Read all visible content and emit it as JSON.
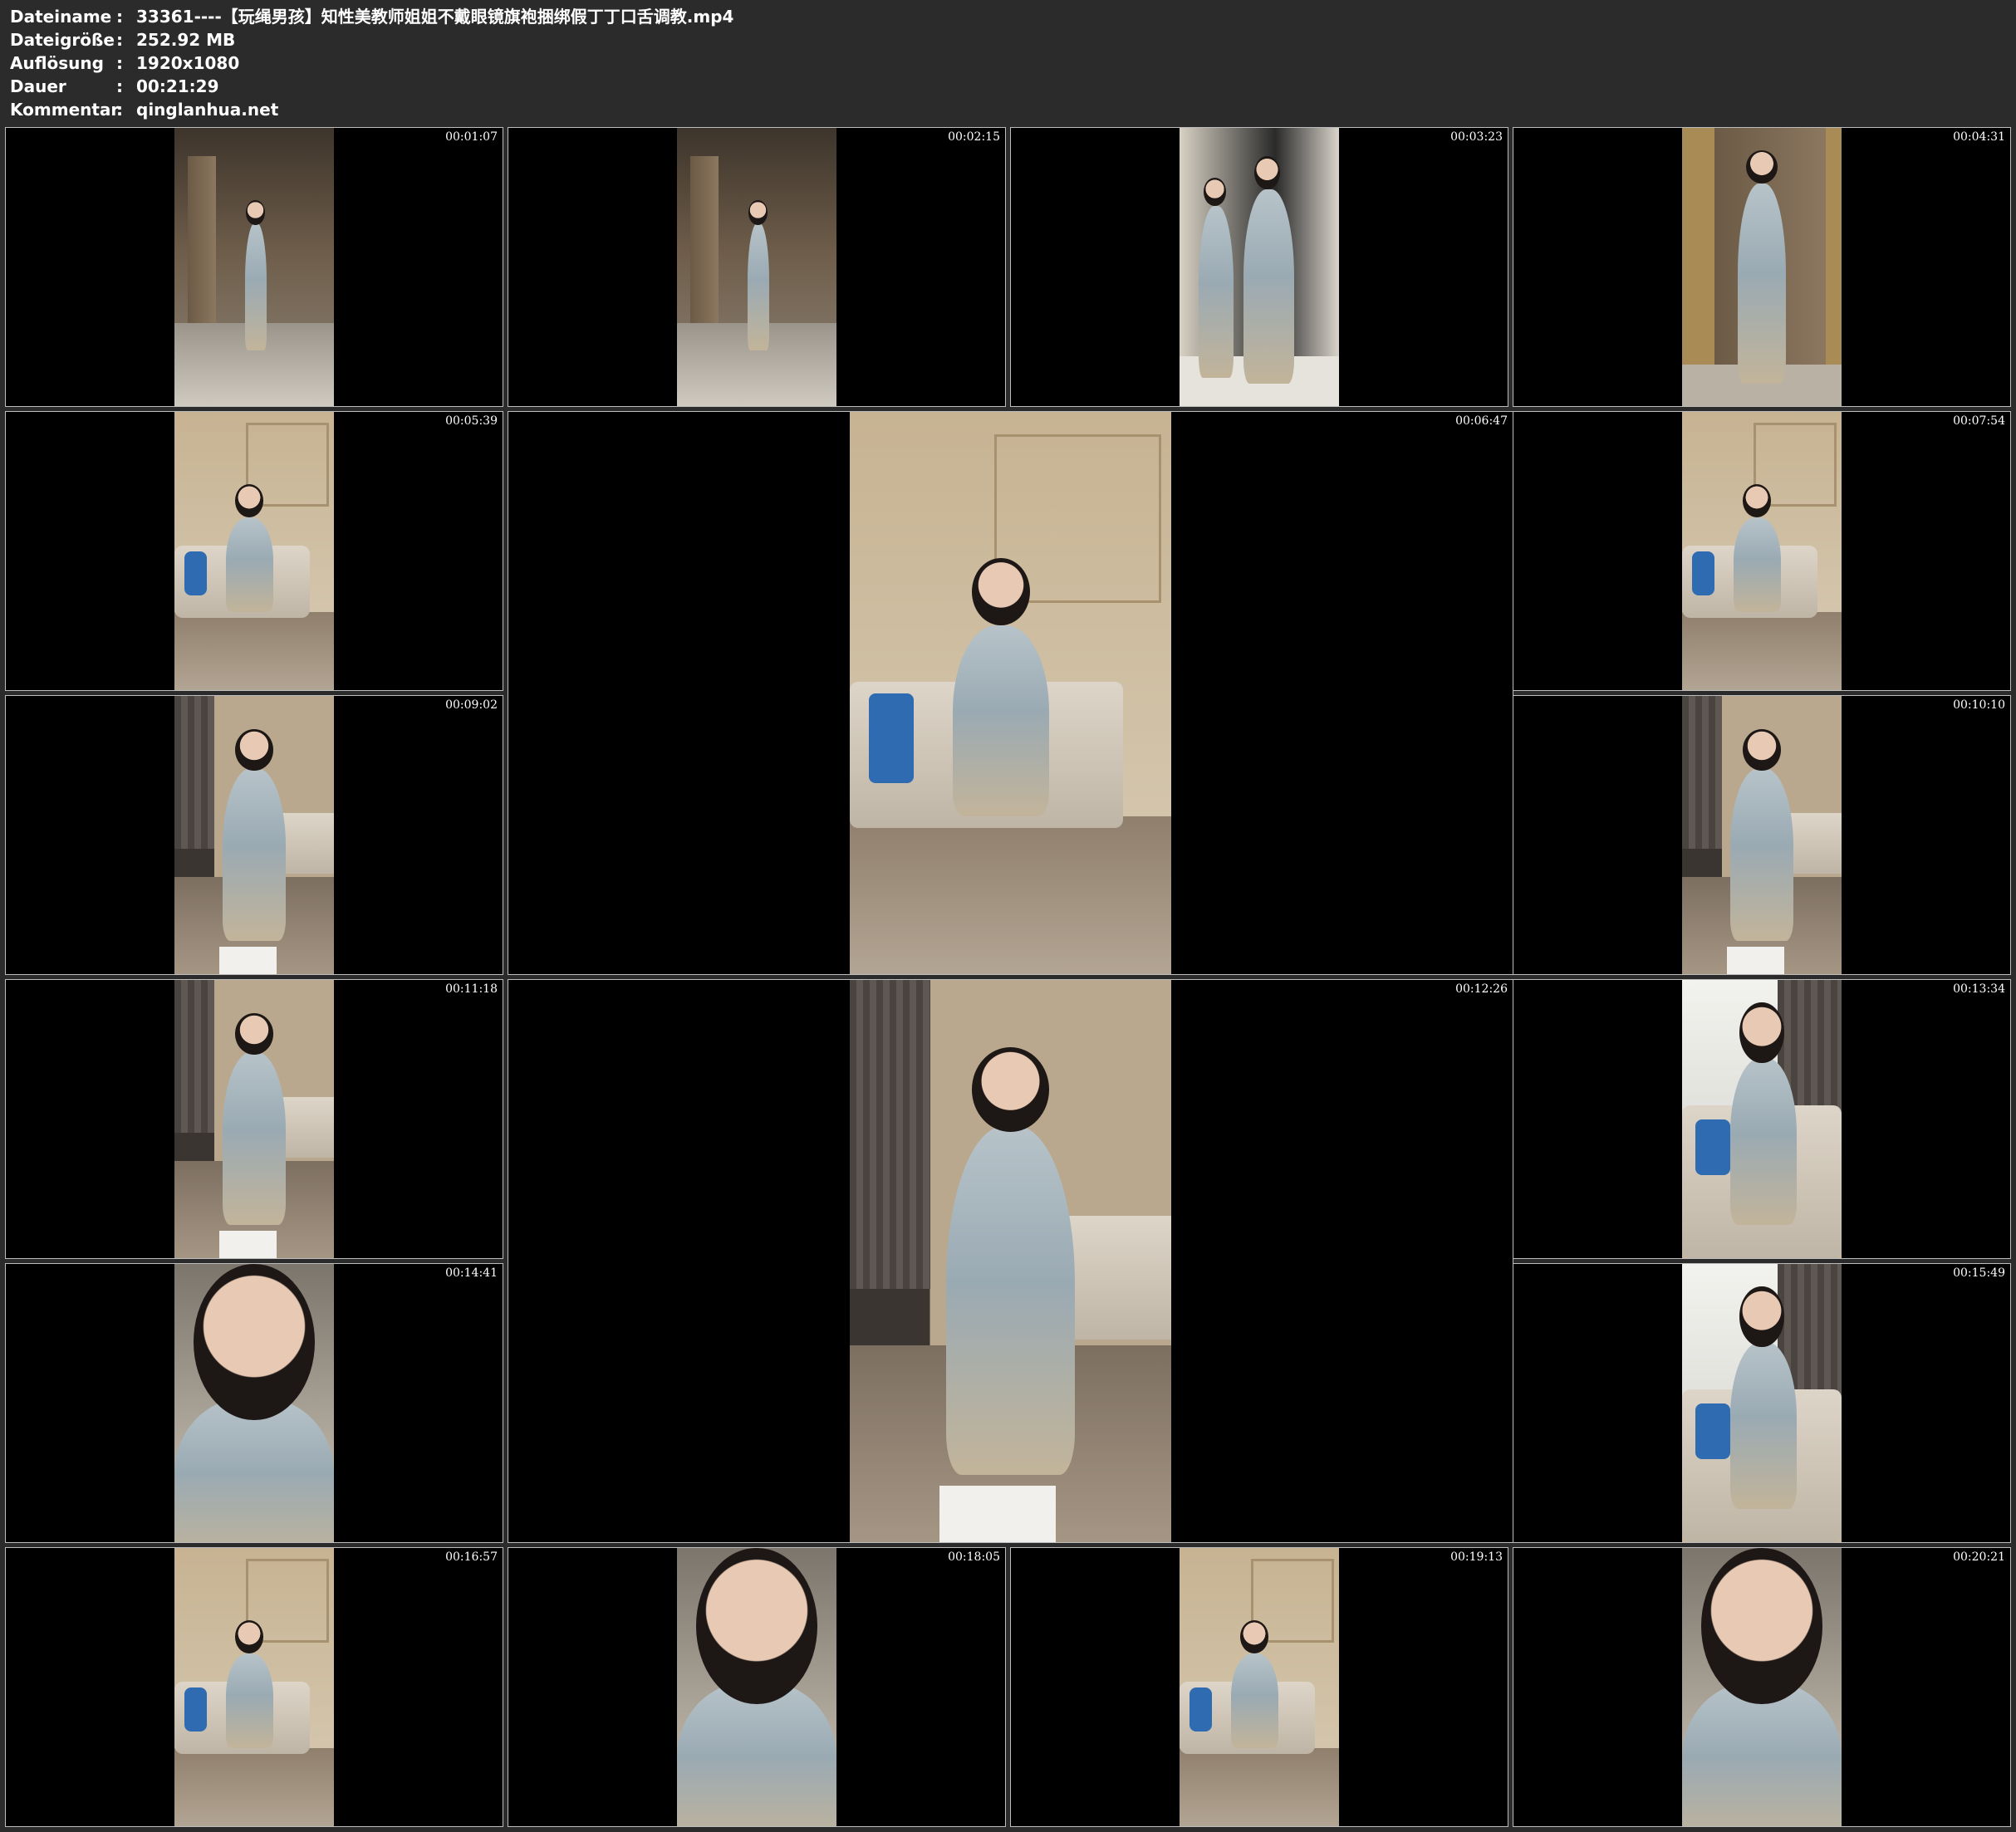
{
  "header": {
    "rows": [
      {
        "key": "Dateiname",
        "sep": ":",
        "value": "33361----【玩绳男孩】知性美教师姐姐不戴眼镜旗袍捆绑假丁丁口舌调教.mp4"
      },
      {
        "key": "Dateigröße",
        "sep": ":",
        "value": "252.92 MB"
      },
      {
        "key": "Auflösung",
        "sep": ":",
        "value": "1920x1080"
      },
      {
        "key": "Dauer",
        "sep": ":",
        "value": "00:21:29"
      },
      {
        "key": "Kommentar",
        "sep": ":",
        "value": "qinglanhua.net"
      }
    ]
  },
  "thumbnails": [
    {
      "time": "00:01:07",
      "scene": "hallway"
    },
    {
      "time": "00:02:15",
      "scene": "hallway"
    },
    {
      "time": "00:03:23",
      "scene": "mirror"
    },
    {
      "time": "00:04:31",
      "scene": "door"
    },
    {
      "time": "00:05:39",
      "scene": "sofa"
    },
    {
      "time": "00:06:47",
      "scene": "sofa"
    },
    {
      "time": "00:07:54",
      "scene": "sofa"
    },
    {
      "time": "00:09:02",
      "scene": "kneel"
    },
    {
      "time": "00:10:10",
      "scene": "kneel"
    },
    {
      "time": "00:11:18",
      "scene": "kneel"
    },
    {
      "time": "00:12:26",
      "scene": "kneel"
    },
    {
      "time": "00:13:34",
      "scene": "window"
    },
    {
      "time": "00:14:41",
      "scene": "closeup"
    },
    {
      "time": "00:15:49",
      "scene": "window"
    },
    {
      "time": "00:16:57",
      "scene": "sofa"
    },
    {
      "time": "00:18:05",
      "scene": "closeup"
    },
    {
      "time": "00:19:13",
      "scene": "sofa"
    },
    {
      "time": "00:20:21",
      "scene": "closeup"
    }
  ],
  "colors": {
    "background": "#2b2b2b",
    "tile_border": "#bdbdbd",
    "wall_warm": "#c9b79c",
    "floor_wood": "#8f7f6c",
    "dress_blue": "#9aaab3"
  }
}
